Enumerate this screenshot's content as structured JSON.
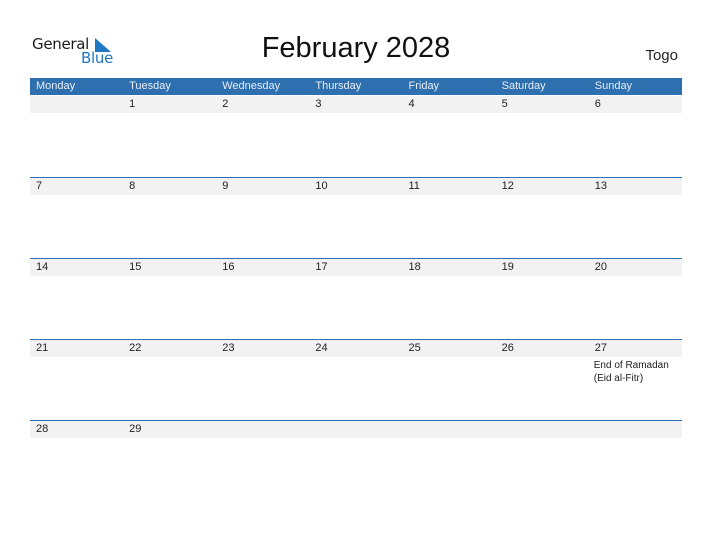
{
  "logo": {
    "line1": "General",
    "line2": "Blue"
  },
  "title": "February 2028",
  "country": "Togo",
  "colors": {
    "header": "#2e6fb0",
    "band": "#f2f2f2",
    "logo_blue": "#1f78c1"
  },
  "weekdays": [
    "Monday",
    "Tuesday",
    "Wednesday",
    "Thursday",
    "Friday",
    "Saturday",
    "Sunday"
  ],
  "weeks": [
    {
      "days": [
        {
          "num": "",
          "event": ""
        },
        {
          "num": "1",
          "event": ""
        },
        {
          "num": "2",
          "event": ""
        },
        {
          "num": "3",
          "event": ""
        },
        {
          "num": "4",
          "event": ""
        },
        {
          "num": "5",
          "event": ""
        },
        {
          "num": "6",
          "event": ""
        }
      ]
    },
    {
      "days": [
        {
          "num": "7",
          "event": ""
        },
        {
          "num": "8",
          "event": ""
        },
        {
          "num": "9",
          "event": ""
        },
        {
          "num": "10",
          "event": ""
        },
        {
          "num": "11",
          "event": ""
        },
        {
          "num": "12",
          "event": ""
        },
        {
          "num": "13",
          "event": ""
        }
      ]
    },
    {
      "days": [
        {
          "num": "14",
          "event": ""
        },
        {
          "num": "15",
          "event": ""
        },
        {
          "num": "16",
          "event": ""
        },
        {
          "num": "17",
          "event": ""
        },
        {
          "num": "18",
          "event": ""
        },
        {
          "num": "19",
          "event": ""
        },
        {
          "num": "20",
          "event": ""
        }
      ]
    },
    {
      "days": [
        {
          "num": "21",
          "event": ""
        },
        {
          "num": "22",
          "event": ""
        },
        {
          "num": "23",
          "event": ""
        },
        {
          "num": "24",
          "event": ""
        },
        {
          "num": "25",
          "event": ""
        },
        {
          "num": "26",
          "event": ""
        },
        {
          "num": "27",
          "event": "End of Ramadan (Eid al-Fitr)"
        }
      ]
    },
    {
      "days": [
        {
          "num": "28",
          "event": ""
        },
        {
          "num": "29",
          "event": ""
        },
        {
          "num": "",
          "event": ""
        },
        {
          "num": "",
          "event": ""
        },
        {
          "num": "",
          "event": ""
        },
        {
          "num": "",
          "event": ""
        },
        {
          "num": "",
          "event": ""
        }
      ]
    }
  ]
}
